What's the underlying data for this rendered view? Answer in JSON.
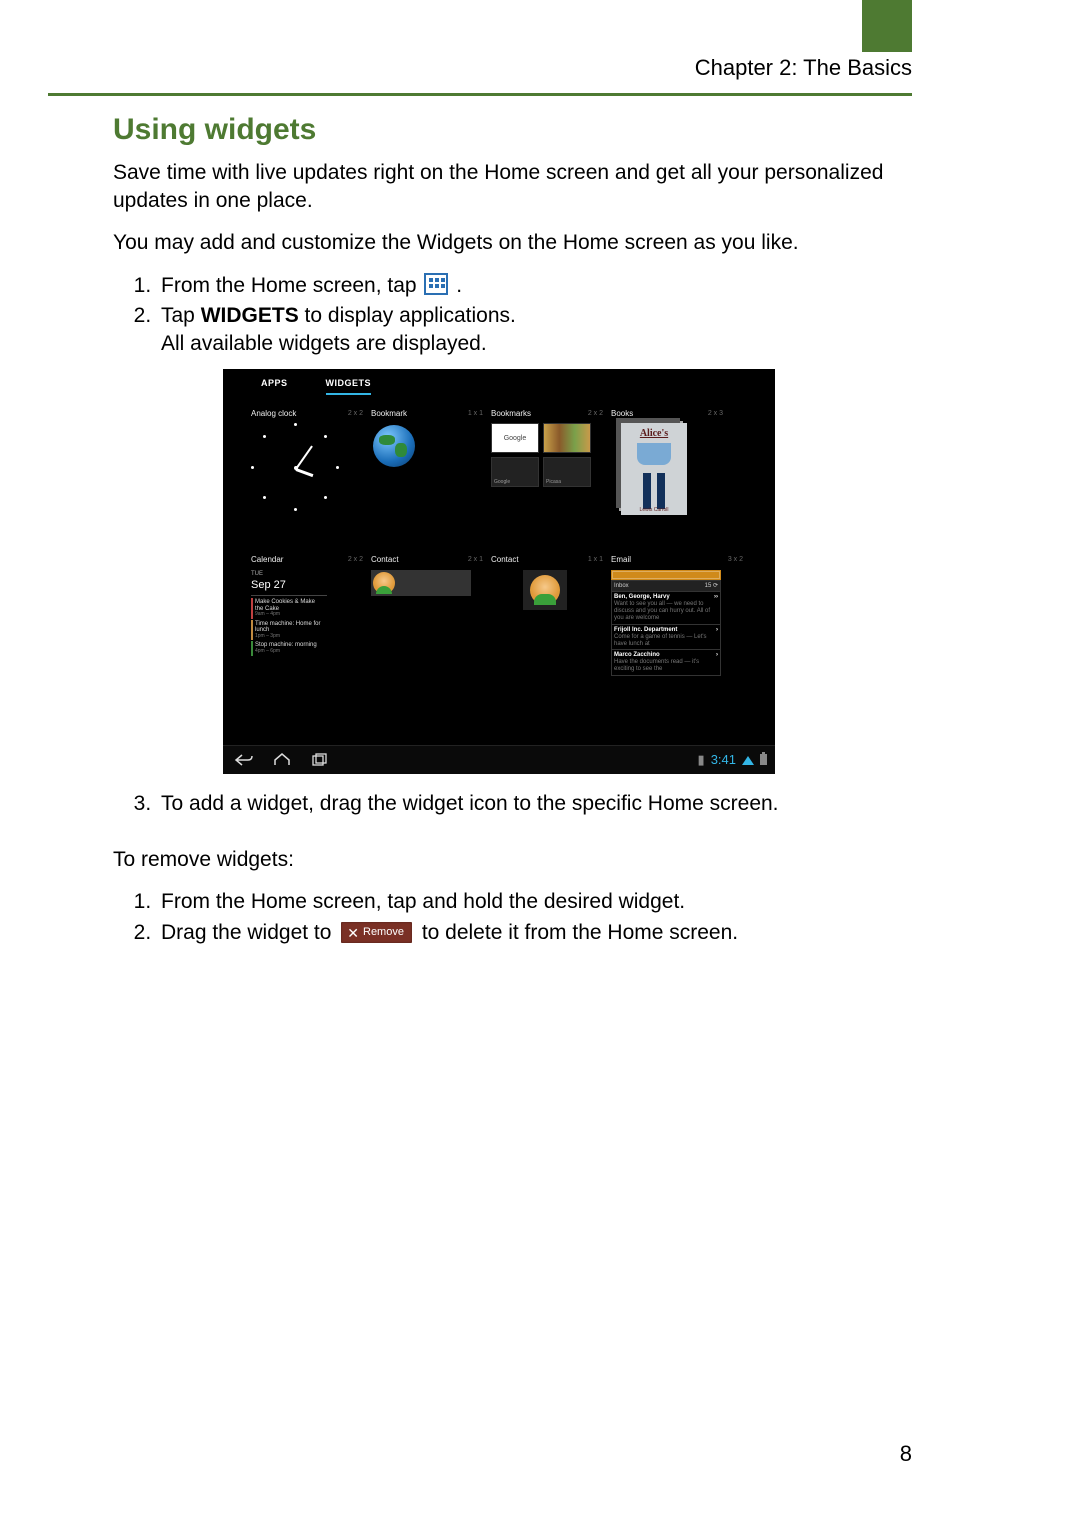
{
  "header": {
    "chapter": "Chapter 2: The Basics"
  },
  "section": {
    "title": "Using widgets"
  },
  "intro1": "Save time with live updates right on the Home screen and get all your personalized updates in one place.",
  "intro2": "You may add and customize the Widgets on the Home screen as you like.",
  "steps1": {
    "s1a": "From the Home screen, tap ",
    "s1b": ".",
    "s2a": "Tap ",
    "s2bold": "WIDGETS",
    "s2b": " to display applications.",
    "s2c": "All available widgets are displayed.",
    "s3": "To add a widget, drag the widget icon to the specific Home screen."
  },
  "remove_intro": "To remove widgets:",
  "steps2": {
    "s1": "From the Home screen, tap and hold the desired widget.",
    "s2a": "Drag the widget to ",
    "remove_label": "Remove",
    "s2b": " to delete it from the Home screen."
  },
  "page_number": "8",
  "shot": {
    "tabs": {
      "apps": "APPS",
      "widgets": "WIDGETS"
    },
    "time": "3:41",
    "widgets": {
      "analog_clock": {
        "name": "Analog clock",
        "dim": "2 x 2"
      },
      "bookmark": {
        "name": "Bookmark",
        "dim": "1 x 1"
      },
      "bookmarks": {
        "name": "Bookmarks",
        "dim": "2 x 2",
        "t_google": "Google",
        "t_picasa": "Picasa"
      },
      "books": {
        "name": "Books",
        "dim": "2 x 3",
        "title": "Alice's",
        "author": "Lewis Carroll"
      },
      "calendar": {
        "name": "Calendar",
        "dim": "2 x 2",
        "tue": "TUE",
        "date": "Sep 27",
        "ev1": "Make Cookies & Make the Cake",
        "ev2": "Time machine: Home for lunch",
        "ev3": "Stop machine: morning"
      },
      "contact_wide": {
        "name": "Contact",
        "dim": "2 x 1"
      },
      "contact_sq": {
        "name": "Contact",
        "dim": "1 x 1"
      },
      "email": {
        "name": "Email",
        "dim": "3 x 2",
        "inbox": "Inbox",
        "count": "15",
        "m1_name": "Ben, George, Harvy",
        "m1_snip": "Want to see you all — we need to discuss and you can hurry out. All of you are welcome",
        "m2_name": "Frijoll Inc. Department",
        "m2_snip": "Come for a game of tennis — Let's have lunch at",
        "m3_name": "Marco Zacchino",
        "m3_snip": "Have the documents read — it's exciting to see the"
      }
    }
  }
}
